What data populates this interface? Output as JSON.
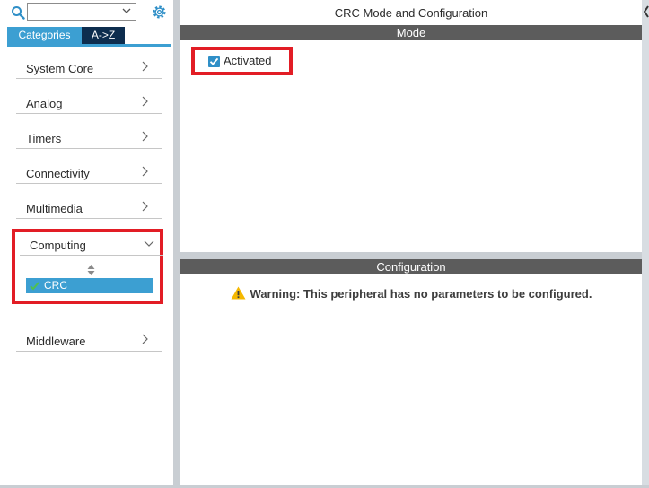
{
  "left_panel": {
    "search": {
      "value": "",
      "placeholder": ""
    },
    "tabs": [
      {
        "label": "Categories",
        "active": true
      },
      {
        "label": "A->Z",
        "active": false
      }
    ],
    "categories": [
      {
        "label": "System Core"
      },
      {
        "label": "Analog"
      },
      {
        "label": "Timers"
      },
      {
        "label": "Connectivity"
      },
      {
        "label": "Multimedia"
      },
      {
        "label": "Computing",
        "expanded": true,
        "items": [
          {
            "label": "CRC",
            "selected": true,
            "enabled": true
          }
        ]
      },
      {
        "label": "Middleware"
      }
    ]
  },
  "right_panel": {
    "title": "CRC Mode and Configuration",
    "mode_header": "Mode",
    "activated_label": "Activated",
    "activated_checked": true,
    "config_header": "Configuration",
    "warning": "Warning: This peripheral has no parameters to be configured."
  },
  "colors": {
    "accent": "#3c9fd2",
    "tab_dark": "#0d2d4e",
    "highlight_border": "#e21d25",
    "header_bar": "#5c5c5c",
    "warning_icon": "#f5b800"
  }
}
